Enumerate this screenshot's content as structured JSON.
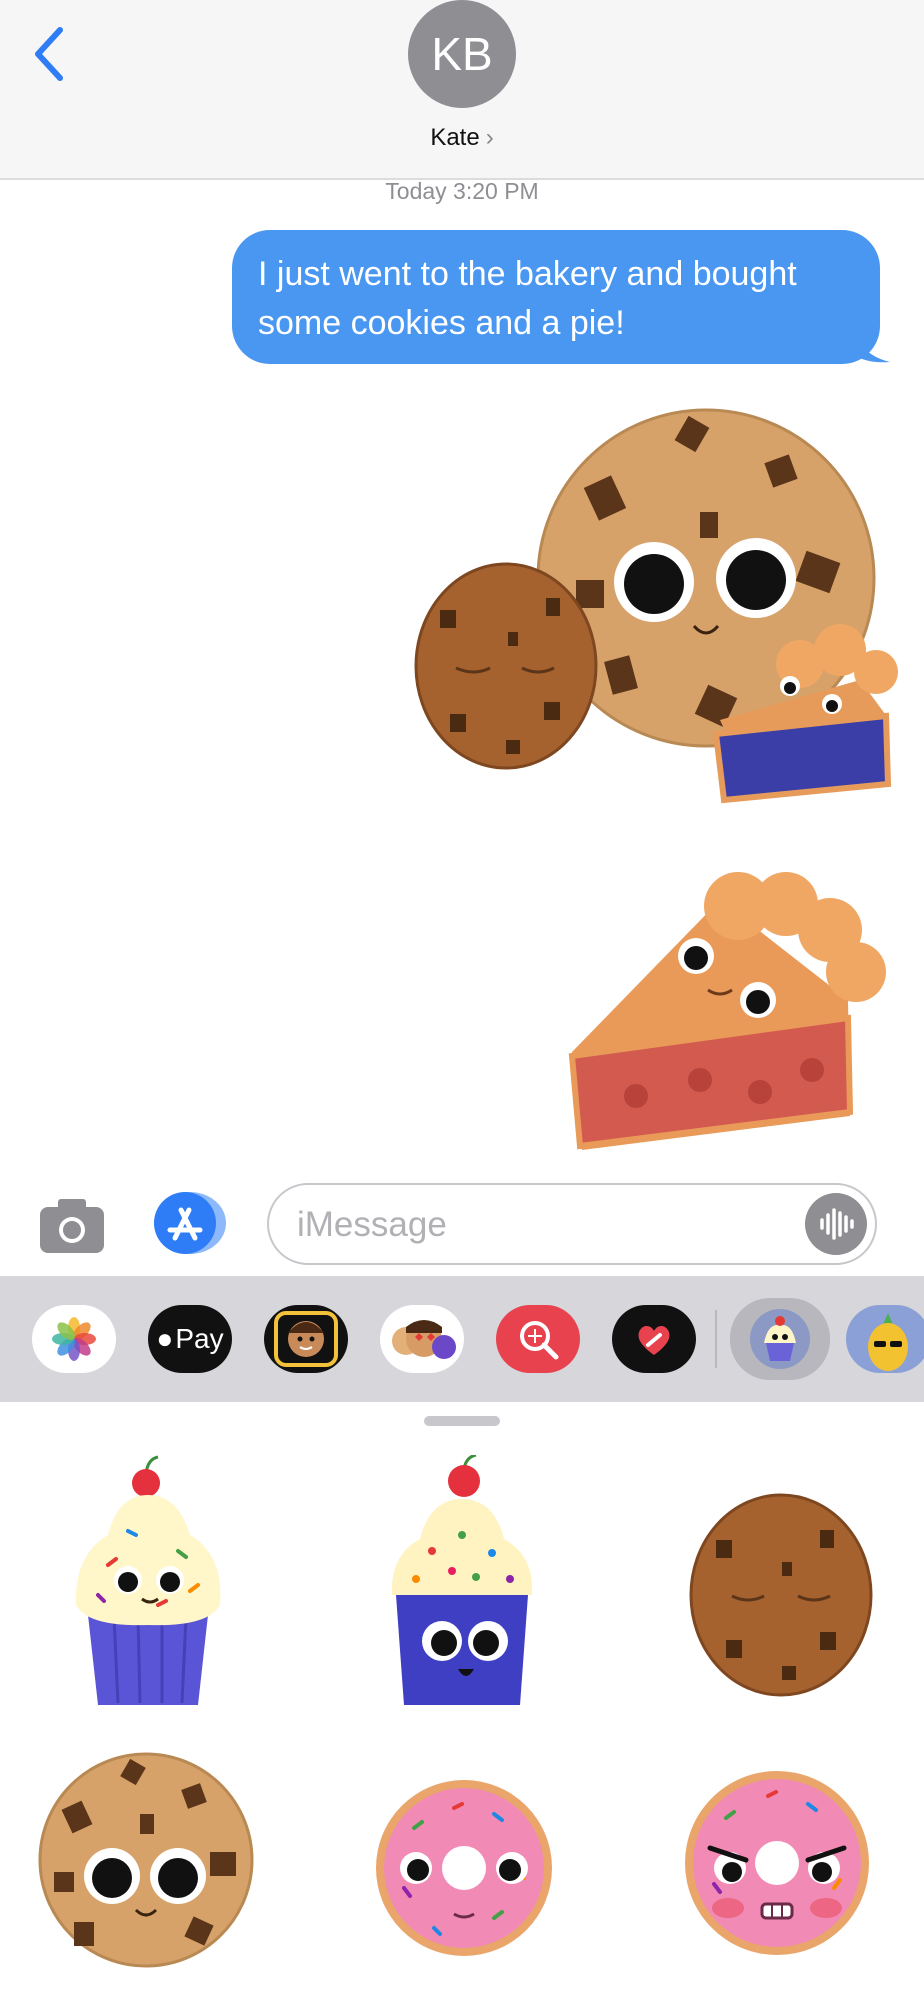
{
  "header": {
    "back_icon": "chevron-left-icon",
    "avatar_initials": "KB",
    "contact_name": "Kate",
    "contact_chevron": "›"
  },
  "conversation": {
    "timestamp": "Today 3:20 PM",
    "message": "I just went to the bakery and bought some cookies and a pie!",
    "stickers_sent": [
      "chocolate-chip-cookie-sticker",
      "sleepy-brown-cookie-sticker",
      "blueberry-pie-slice-sticker",
      "cherry-pie-slice-sticker"
    ]
  },
  "input": {
    "camera_icon": "camera-icon",
    "appstore_icon": "app-store-icon",
    "placeholder": "iMessage",
    "mic_icon": "audio-waveform-icon"
  },
  "app_drawer": {
    "apps": [
      {
        "name": "photos-app",
        "label": ""
      },
      {
        "name": "apple-pay-app",
        "label": "Pay"
      },
      {
        "name": "memoji-app",
        "label": ""
      },
      {
        "name": "memoji-stickers-app",
        "label": ""
      },
      {
        "name": "image-search-app",
        "label": ""
      },
      {
        "name": "digital-touch-app",
        "label": ""
      },
      {
        "name": "bakery-stickers-app",
        "label": ""
      },
      {
        "name": "pineapple-stickers-app",
        "label": ""
      }
    ]
  },
  "sticker_panel": {
    "stickers": [
      "vanilla-cupcake-sticker",
      "blue-cupcake-sticker",
      "sleepy-cookie-sticker",
      "chocolate-chip-cookie-sticker",
      "pink-donut-sticker",
      "angry-pink-donut-sticker"
    ]
  },
  "colors": {
    "bubble": "#4a97f1",
    "accent": "#2f7df6",
    "header_bg": "#f6f6f6",
    "drawer_bg": "#d6d6db"
  }
}
